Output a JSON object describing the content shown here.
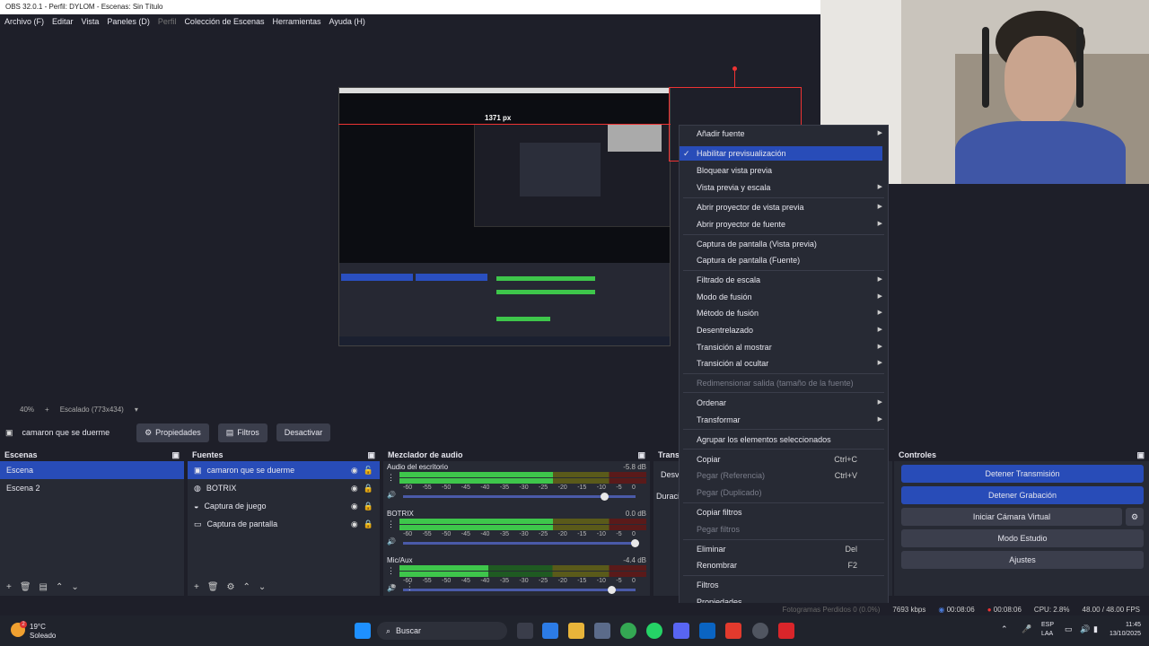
{
  "window": {
    "title": "OBS 32.0.1 - Perfil: DYLOM - Escenas: Sin Título"
  },
  "menubar": [
    "Archivo (F)",
    "Editar",
    "Vista",
    "Paneles (D)",
    "Perfil",
    "Colección de Escenas",
    "Herramientas",
    "Ayuda (H)"
  ],
  "preview": {
    "measure_label": "1371 px",
    "zoom": "40%",
    "scale_label": "Escalado (773x434)"
  },
  "scene_toolbar": {
    "source_name": "camaron que se duerme",
    "properties": "Propiedades",
    "filters": "Filtros",
    "deactivate": "Desactivar"
  },
  "scenes": {
    "title": "Escenas",
    "items": [
      "Escena",
      "Escena 2"
    ]
  },
  "sources": {
    "title": "Fuentes",
    "items": [
      "camaron que se duerme",
      "BOTRIX",
      "Captura de juego",
      "Captura de pantalla"
    ]
  },
  "mixer": {
    "title": "Mezclador de audio",
    "channels": [
      {
        "name": "Audio del escritorio",
        "db": "-5.8 dB",
        "level": 0.62,
        "volume": 0.87
      },
      {
        "name": "BOTRIX",
        "db": "0.0 dB",
        "level": 0.62,
        "volume": 1.0
      },
      {
        "name": "Mic/Aux",
        "db": "-4.4 dB",
        "level": 0.36,
        "volume": 0.9
      }
    ],
    "ticks": [
      "-60",
      "-55",
      "-50",
      "-45",
      "-40",
      "-35",
      "-30",
      "-25",
      "-20",
      "-15",
      "-10",
      "-5",
      "0"
    ]
  },
  "transitions": {
    "title": "Transi",
    "partial1": "Desva",
    "partial2": "Duraci"
  },
  "controls": {
    "title": "Controles",
    "stop_stream": "Detener Transmisión",
    "stop_record": "Detener Grabación",
    "virtual_cam": "Iniciar Cámara Virtual",
    "studio": "Modo Estudio",
    "settings": "Ajustes"
  },
  "context_menu": {
    "add_source": "Añadir fuente",
    "enable_preview": "Habilitar previsualización",
    "lock_preview": "Bloquear vista previa",
    "preview_scale": "Vista previa y escala",
    "open_preview_projector": "Abrir proyector de vista previa",
    "open_source_projector": "Abrir proyector de fuente",
    "screenshot_preview": "Captura de pantalla (Vista previa)",
    "screenshot_source": "Captura de pantalla (Fuente)",
    "scale_filter": "Filtrado de escala",
    "blend_mode": "Modo de fusión",
    "blend_method": "Método de fusión",
    "deinterlace": "Desentrelazado",
    "show_transition": "Transición al mostrar",
    "hide_transition": "Transición al ocultar",
    "resize_output": "Redimensionar salida (tamaño de la fuente)",
    "order": "Ordenar",
    "transform": "Transformar",
    "group": "Agrupar los elementos seleccionados",
    "copy": "Copiar",
    "copy_sc": "Ctrl+C",
    "paste_ref": "Pegar (Referencia)",
    "paste_ref_sc": "Ctrl+V",
    "paste_dup": "Pegar (Duplicado)",
    "copy_filters": "Copiar filtros",
    "paste_filters": "Pegar filtros",
    "delete": "Eliminar",
    "delete_sc": "Del",
    "rename": "Renombrar",
    "rename_sc": "F2",
    "filters": "Filtros",
    "properties": "Propiedades"
  },
  "statusbar": {
    "dropped": "Fotogramas Perdidos 0 (0.0%)",
    "bitrate": "7693 kbps",
    "stream_time": "00:08:06",
    "rec_time": "00:08:06",
    "cpu": "CPU: 2.8%",
    "fps": "48.00 / 48.00 FPS"
  },
  "taskbar": {
    "weather_temp": "19°C",
    "weather_desc": "Soleado",
    "search": "Buscar",
    "lang": "ESP",
    "lang2": "LAA",
    "time": "11:45",
    "date": "13/10/2025",
    "badge": "2"
  },
  "colors": {
    "accent": "#284cb8",
    "selection": "#e33333",
    "meter_green": "#3ec64b"
  }
}
